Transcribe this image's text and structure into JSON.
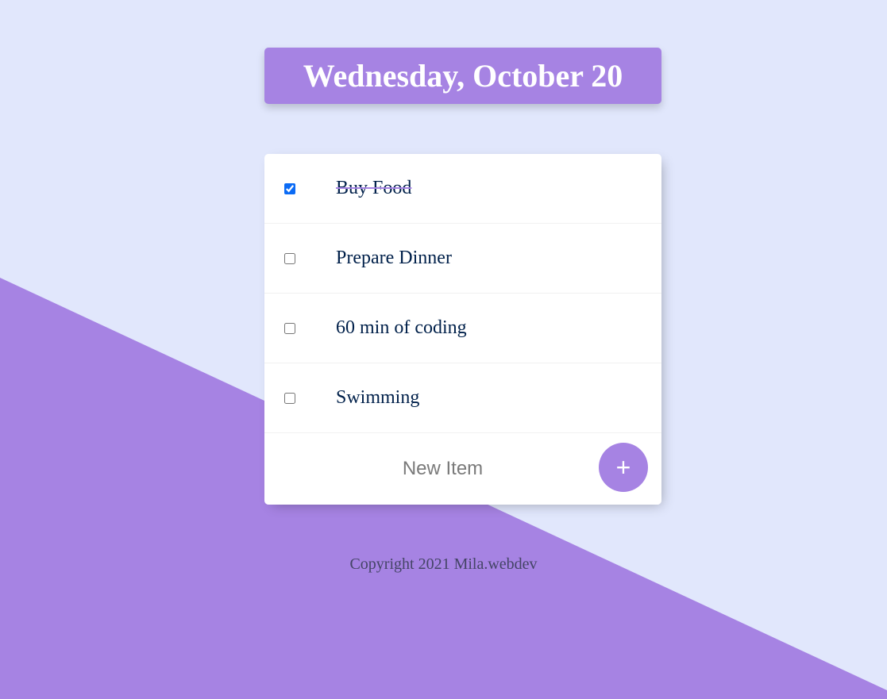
{
  "header": {
    "title": "Wednesday, October 20"
  },
  "list": {
    "items": [
      {
        "label": "Buy Food",
        "checked": true
      },
      {
        "label": "Prepare Dinner",
        "checked": false
      },
      {
        "label": "60 min of coding",
        "checked": false
      },
      {
        "label": "Swimming",
        "checked": false
      }
    ]
  },
  "new_item": {
    "placeholder": "New Item",
    "add_button_label": "+"
  },
  "footer": {
    "text": "Copyright 2021 Mila.webdev"
  },
  "colors": {
    "accent": "#A683E3",
    "background": "#E1E7FC",
    "text": "#00204A"
  }
}
